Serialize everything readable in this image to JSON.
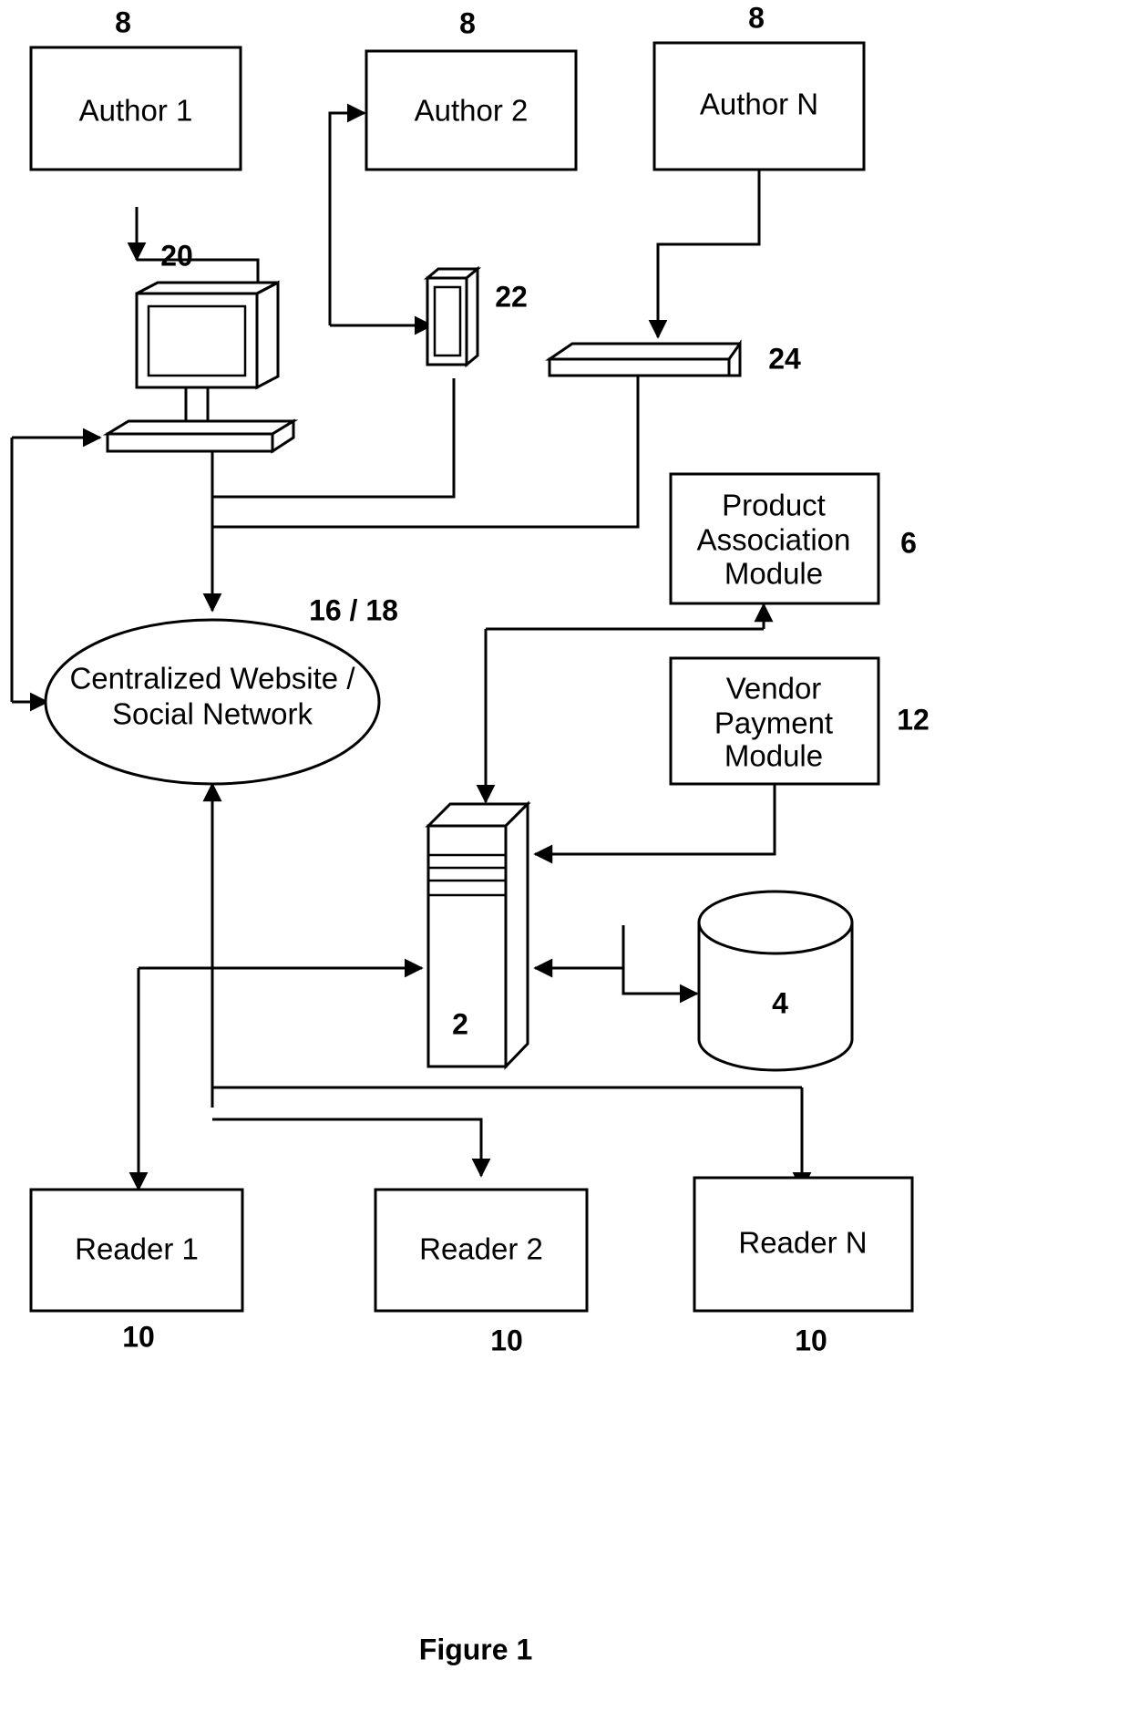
{
  "figure": {
    "caption": "Figure 1"
  },
  "nodes": {
    "author1": {
      "label": "Author 1",
      "ref": "8"
    },
    "author2": {
      "label": "Author 2",
      "ref": "8"
    },
    "authorN": {
      "label": "Author N",
      "ref": "8"
    },
    "desktop_computer": {
      "ref": "20",
      "icon": "desktop-computer-icon"
    },
    "mobile_phone": {
      "ref": "22",
      "icon": "mobile-phone-icon"
    },
    "tablet_device": {
      "ref": "24",
      "icon": "tablet-device-icon"
    },
    "centralized_website": {
      "label_line1": "Centralized Website /",
      "label_line2": "Social Network",
      "ref": "16 / 18"
    },
    "product_association_module": {
      "label_line1": "Product",
      "label_line2": "Association",
      "label_line3": "Module",
      "ref": "6"
    },
    "vendor_payment_module": {
      "label_line1": "Vendor",
      "label_line2": "Payment",
      "label_line3": "Module",
      "ref": "12"
    },
    "server": {
      "ref": "2",
      "icon": "server-tower-icon"
    },
    "database": {
      "ref": "4",
      "icon": "database-cylinder-icon"
    },
    "reader1": {
      "label": "Reader 1",
      "ref": "10"
    },
    "reader2": {
      "label": "Reader 2",
      "ref": "10"
    },
    "readerN": {
      "label": "Reader N",
      "ref": "10"
    }
  },
  "colors": {
    "stroke": "#000000",
    "fill": "#ffffff",
    "text": "#000000"
  }
}
